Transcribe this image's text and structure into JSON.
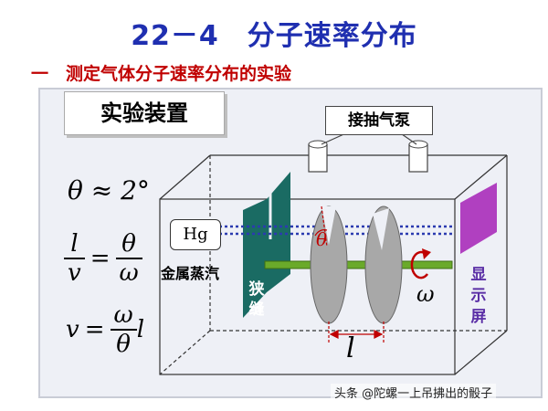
{
  "header": {
    "title": "22－4　分子速率分布",
    "subtitle": "一　测定气体分子速率分布的实验"
  },
  "apparatus": {
    "section_label": "实验装置",
    "pump_label": "接抽气泵",
    "mercury_symbol": "Hg",
    "mercury_label": "金属蒸汽",
    "slit_label": "狭缝",
    "screen_label": "显示屏",
    "distance_symbol": "l",
    "omega_symbol": "ω",
    "theta_symbol": "θ"
  },
  "formulas": {
    "f1": "θ ≈ 2°",
    "f2_lhs_num": "l",
    "f2_lhs_den": "v",
    "f2_rhs_num": "θ",
    "f2_rhs_den": "ω",
    "f3_lhs": "v",
    "f3_num": "ω",
    "f3_den": "θ",
    "f3_tail": "l",
    "equals": "="
  },
  "watermark": "头条 @陀螺一上吊拂出的骰子",
  "colors": {
    "title": "#1f2fb0",
    "subtitle": "#c00000",
    "slit": "#1a6b63",
    "screen": "#b040c0",
    "axle": "#6aaa2a",
    "beam": "#2b3bb0"
  }
}
